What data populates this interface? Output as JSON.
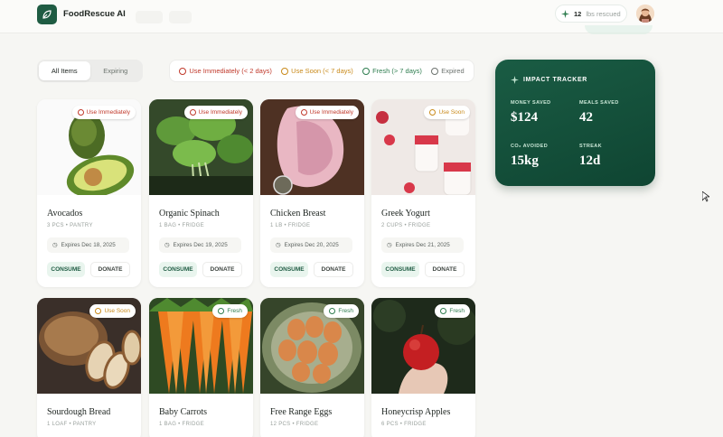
{
  "app": {
    "name": "FoodRescue AI"
  },
  "header": {
    "rescued_count": "12",
    "rescued_label": "lbs rescued"
  },
  "tabs": [
    {
      "label": "All Items",
      "active": true
    },
    {
      "label": "Expiring",
      "active": false
    }
  ],
  "legend": [
    {
      "label": "Use Immediately (< 2 days)",
      "color": "#c0392b"
    },
    {
      "label": "Use Soon (< 7 days)",
      "color": "#c98a1b"
    },
    {
      "label": "Fresh (> 7 days)",
      "color": "#2e7d4f"
    },
    {
      "label": "Expired",
      "color": "#8a8f8c"
    }
  ],
  "items": [
    {
      "name": "Avocados",
      "meta": "3 PCS • PANTRY",
      "expires": "Expires Dec 18, 2025",
      "status": "Use Immediately"
    },
    {
      "name": "Organic Spinach",
      "meta": "1 BAG • FRIDGE",
      "expires": "Expires Dec 19, 2025",
      "status": "Use Immediately"
    },
    {
      "name": "Chicken Breast",
      "meta": "1 LB • FRIDGE",
      "expires": "Expires Dec 20, 2025",
      "status": "Use Immediately"
    },
    {
      "name": "Greek Yogurt",
      "meta": "2 CUPS • FRIDGE",
      "expires": "Expires Dec 21, 2025",
      "status": "Use Soon"
    },
    {
      "name": "Sourdough Bread",
      "meta": "1 LOAF • PANTRY",
      "status": "Use Soon"
    },
    {
      "name": "Baby Carrots",
      "meta": "1 BAG • FRIDGE",
      "status": "Fresh"
    },
    {
      "name": "Free Range Eggs",
      "meta": "12 PCS • FRIDGE",
      "status": "Fresh"
    },
    {
      "name": "Honeycrisp Apples",
      "meta": "6 PCS • FRIDGE",
      "status": "Fresh"
    }
  ],
  "actions": {
    "consume": "CONSUME",
    "donate": "DONATE"
  },
  "impact": {
    "title": "IMPACT TRACKER",
    "money_saved_label": "MONEY SAVED",
    "money_saved": "$124",
    "meals_saved_label": "MEALS SAVED",
    "meals_saved": "42",
    "co2_label": "CO₂ AVOIDED",
    "co2": "15kg",
    "streak_label": "STREAK",
    "streak": "12d"
  }
}
